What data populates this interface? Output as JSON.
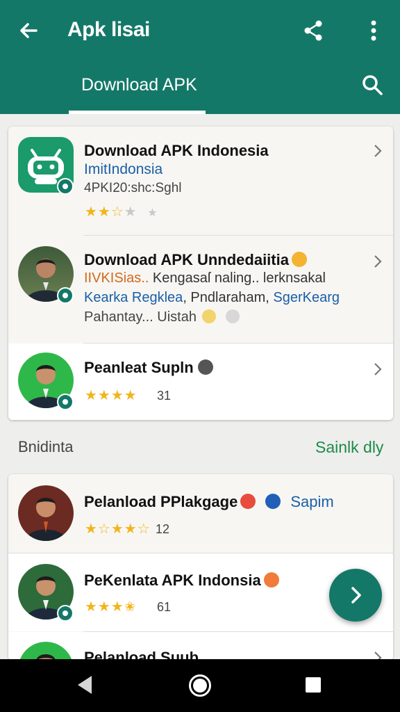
{
  "appbar": {
    "title": "Apk lisai",
    "tab_label": "Download APK",
    "icons": [
      "arrow-back-icon",
      "share-icon",
      "more-vert-icon",
      "search-icon"
    ],
    "color": "#147868"
  },
  "card1": {
    "items": [
      {
        "title": "Download APK Indonesia",
        "subtitle": "ImitIndonsia",
        "meta": "4PKI20:shc:Sghl",
        "rating": 2.5
      },
      {
        "title": "Download APK Unndedaiitia",
        "line2_orange": "IIVKISias..",
        "line2_rest": " Kengasaſ naling.. lerknsakal",
        "line3_a": "Kearka Regklea",
        "line3_b": ",  Pndlaraham, ",
        "line3_c": "SgerKearg",
        "line4": "Pahantay... Uistah"
      },
      {
        "title": "Peanleat Supln",
        "rating": 4,
        "count": "31"
      }
    ]
  },
  "section": {
    "title": "Bnidinta",
    "action": "Sainlk dly"
  },
  "card2": {
    "items": [
      {
        "title": "Pelanload PPlakgage",
        "tag": "Sapim",
        "rating": 3.5,
        "count": "12"
      },
      {
        "title": "PeKenlata APK Indonsia",
        "rating": 3.5,
        "count": "61"
      },
      {
        "title": "Pelanload Suub"
      }
    ]
  },
  "colors": {
    "accent": "#147868",
    "link": "#1a5fa8",
    "orange": "#d2691e",
    "green_action": "#1d8a4a",
    "star": "#f1b51c"
  }
}
